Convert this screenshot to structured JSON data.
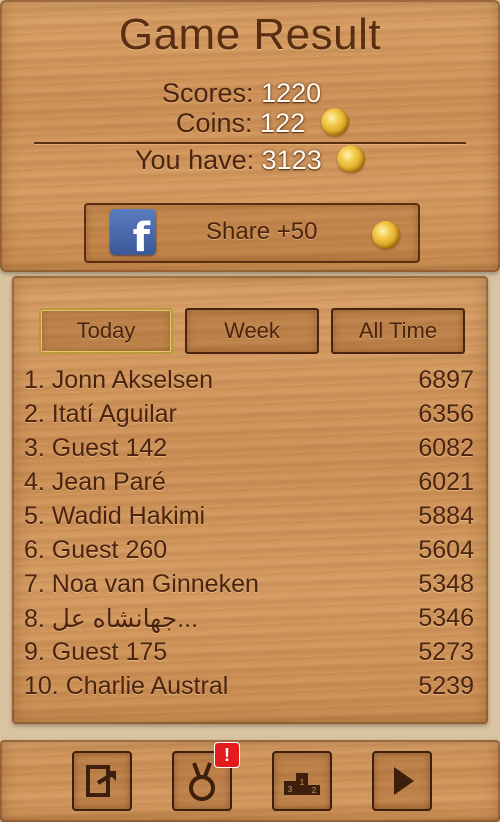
{
  "title": "Game Result",
  "stats": {
    "scores_label": "Scores:",
    "scores_value": "1220",
    "coins_label": "Coins:",
    "coins_value": "122",
    "have_label": "You have:",
    "have_value": "3123"
  },
  "share": {
    "icon_letter": "f",
    "label": "Share +50"
  },
  "tabs": [
    {
      "label": "Today",
      "active": true
    },
    {
      "label": "Week",
      "active": false
    },
    {
      "label": "All Time",
      "active": false
    }
  ],
  "leaderboard": [
    {
      "name": "1. Jonn Akselsen",
      "score": "6897"
    },
    {
      "name": "2. Itatí Aguilar",
      "score": "6356"
    },
    {
      "name": "3. Guest 142",
      "score": "6082"
    },
    {
      "name": "4. Jean Paré",
      "score": "6021"
    },
    {
      "name": "5. Wadid Hakimi",
      "score": "5884"
    },
    {
      "name": "6. Guest 260",
      "score": "5604"
    },
    {
      "name": "7. Noa van Ginneken",
      "score": "5348"
    },
    {
      "name": "8. جهانشاه عل...",
      "score": "5346"
    },
    {
      "name": "9. Guest 175",
      "score": "5273"
    },
    {
      "name": "10. Charlie Austral",
      "score": "5239"
    }
  ],
  "bottom_bar": {
    "buttons": [
      "exit-icon",
      "medal-icon",
      "podium-icon",
      "play-icon"
    ],
    "badge": "!",
    "podium_numbers": [
      "2",
      "1",
      "3"
    ]
  },
  "colors": {
    "text": "#4a2410",
    "title": "#5a2e12",
    "badge": "#e41b1b",
    "facebook": "#3b5998"
  }
}
